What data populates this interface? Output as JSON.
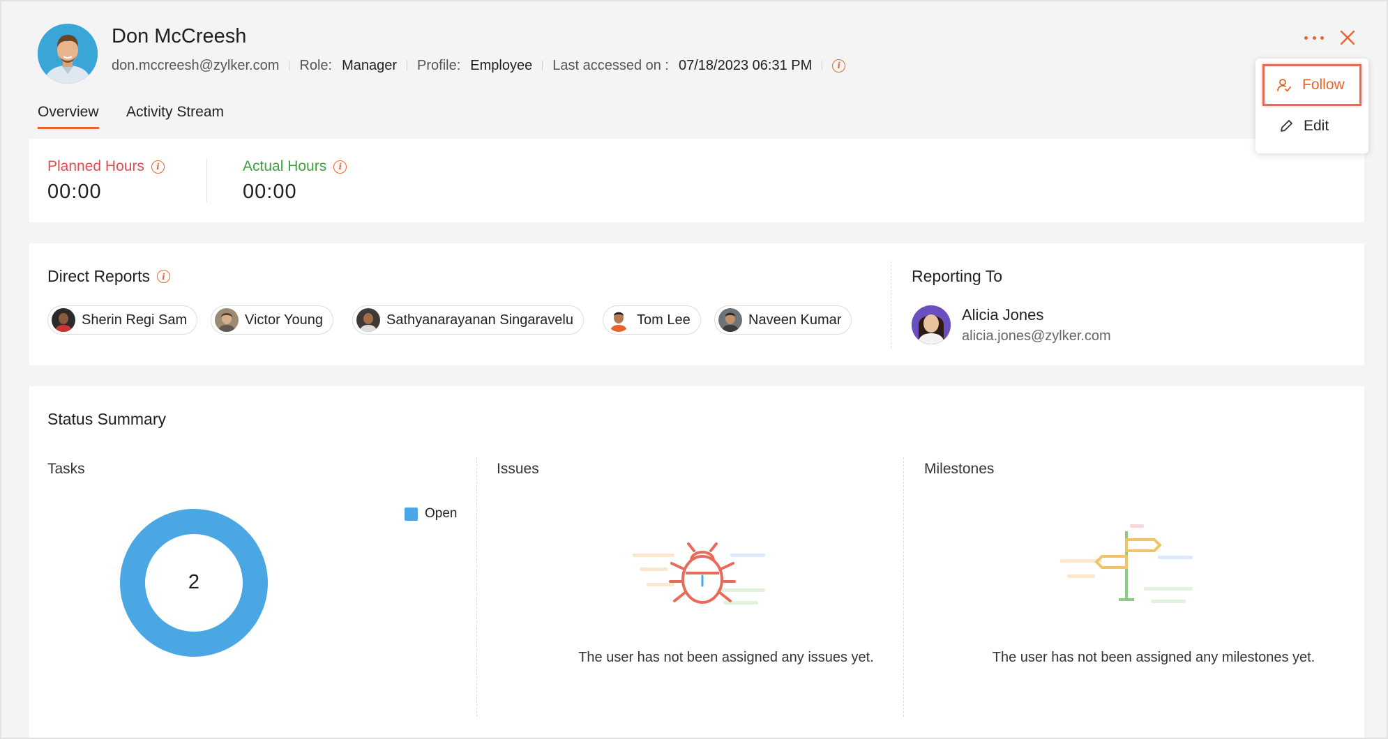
{
  "user": {
    "name": "Don McCreesh",
    "email": "don.mccreesh@zylker.com",
    "role_label": "Role:",
    "role": "Manager",
    "profile_label": "Profile:",
    "profile": "Employee",
    "last_accessed_label": "Last accessed on :",
    "last_accessed": "07/18/2023 06:31 PM"
  },
  "tabs": [
    {
      "label": "Overview",
      "active": true
    },
    {
      "label": "Activity Stream",
      "active": false
    }
  ],
  "hours": {
    "planned_label": "Planned Hours",
    "planned_value": "00:00",
    "planned_color": "#e04f4f",
    "actual_label": "Actual Hours",
    "actual_value": "00:00",
    "actual_color": "#3fa140"
  },
  "direct_reports": {
    "title": "Direct Reports",
    "people": [
      {
        "name": "Sherin Regi Sam"
      },
      {
        "name": "Victor Young"
      },
      {
        "name": "Sathyanarayanan Singaravelu"
      },
      {
        "name": "Tom Lee"
      },
      {
        "name": "Naveen Kumar"
      }
    ]
  },
  "reporting_to": {
    "title": "Reporting To",
    "name": "Alicia Jones",
    "email": "alicia.jones@zylker.com"
  },
  "status_summary": {
    "title": "Status Summary",
    "tasks": {
      "title": "Tasks",
      "legend": "Open",
      "total": "2",
      "color": "#4aa7e3"
    },
    "issues": {
      "title": "Issues",
      "empty_message": "The user has not been assigned any issues yet."
    },
    "milestones": {
      "title": "Milestones",
      "empty_message": "The user has not been assigned any milestones yet."
    }
  },
  "menu": {
    "follow_label": "Follow",
    "edit_label": "Edit"
  },
  "colors": {
    "accent": "#e8642a"
  }
}
